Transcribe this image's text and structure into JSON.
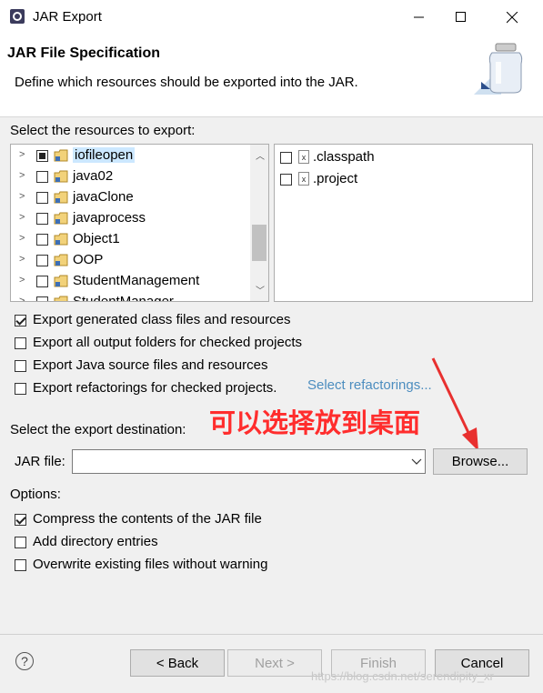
{
  "window": {
    "title": "JAR Export"
  },
  "header": {
    "title": "JAR File Specification",
    "description": "Define which resources should be exported into the JAR."
  },
  "resources": {
    "label": "Select the resources to export:",
    "projects": [
      {
        "name": "iofileopen",
        "state": "partial",
        "selected": true
      },
      {
        "name": "java02",
        "state": "unchecked"
      },
      {
        "name": "javaClone",
        "state": "unchecked"
      },
      {
        "name": "javaprocess",
        "state": "unchecked"
      },
      {
        "name": "Object1",
        "state": "unchecked"
      },
      {
        "name": "OOP",
        "state": "unchecked"
      },
      {
        "name": "StudentManagement",
        "state": "unchecked"
      },
      {
        "name": "StudentManager",
        "state": "unchecked"
      }
    ],
    "files": [
      {
        "name": ".classpath",
        "state": "unchecked"
      },
      {
        "name": ".project",
        "state": "unchecked"
      }
    ]
  },
  "export_options": [
    {
      "label": "Export generated class files and resources",
      "checked": true
    },
    {
      "label": "Export all output folders for checked projects",
      "checked": false
    },
    {
      "label": "Export Java source files and resources",
      "checked": false
    },
    {
      "label": "Export refactorings for checked projects.",
      "checked": false
    }
  ],
  "select_refactorings_link": "Select refactorings...",
  "annotation": {
    "text": "可以选择放到桌面",
    "color": "#ff2d2d"
  },
  "destination": {
    "label": "Select the export destination:",
    "jar_file_label": "JAR file:",
    "jar_file_value": "",
    "browse_label": "Browse..."
  },
  "options": {
    "label": "Options:",
    "items": [
      {
        "label": "Compress the contents of the JAR file",
        "checked": true
      },
      {
        "label": "Add directory entries",
        "checked": false
      },
      {
        "label": "Overwrite existing files without warning",
        "checked": false
      }
    ]
  },
  "footer": {
    "help_symbol": "?",
    "back_label": "< Back",
    "next_label": "Next >",
    "finish_label": "Finish",
    "cancel_label": "Cancel",
    "watermark": "https://blog.csdn.net/serendipity_xr"
  },
  "colors": {
    "link": "#4c8dbf",
    "selection": "#cce8ff",
    "accent_red": "#e8302f"
  }
}
